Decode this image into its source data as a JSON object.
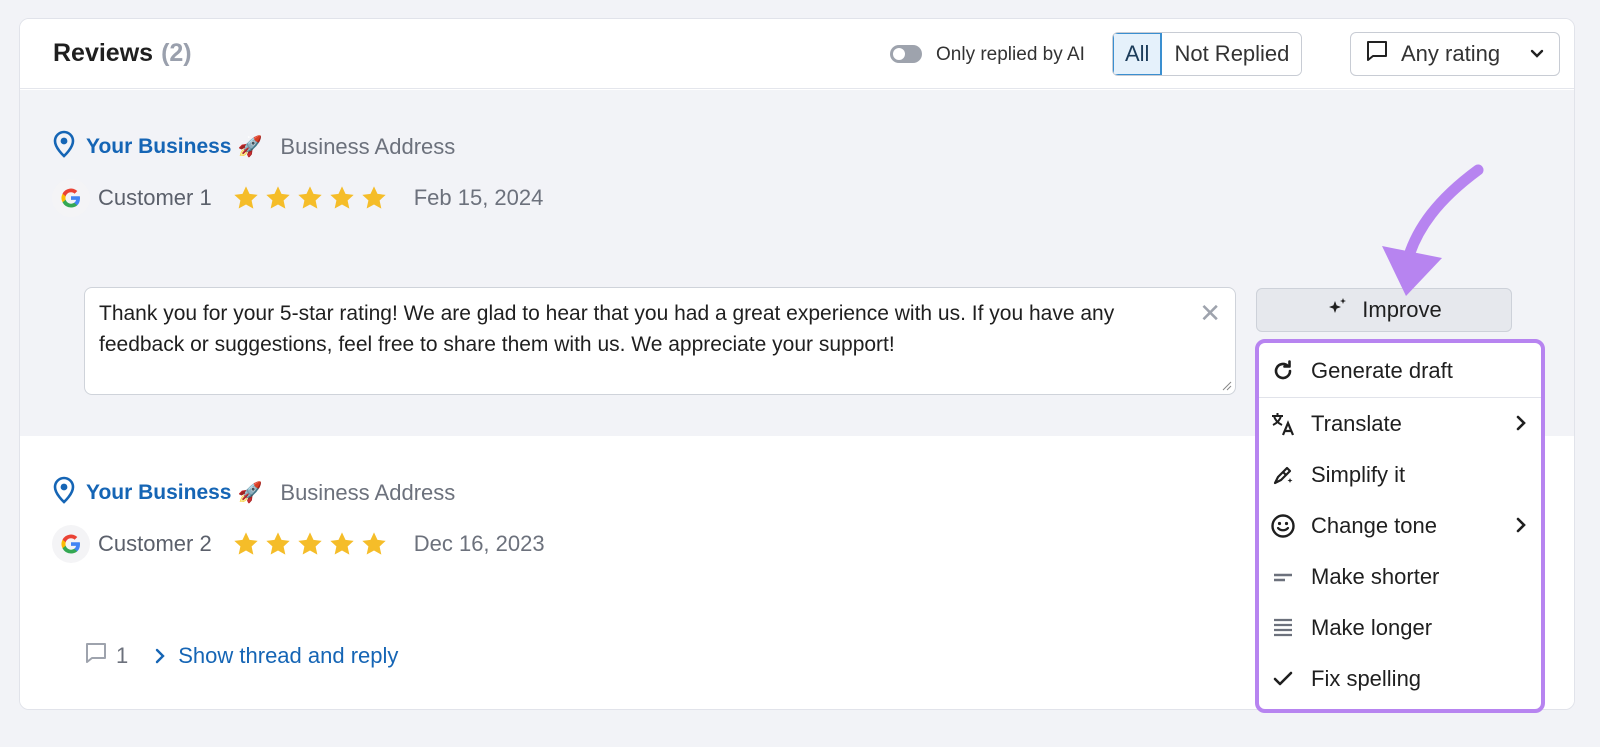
{
  "header": {
    "title": "Reviews",
    "count": "(2)",
    "toggle_label": "Only replied by AI",
    "filter_all": "All",
    "filter_not_replied": "Not Replied",
    "rating_filter": "Any rating"
  },
  "reviews": [
    {
      "business": "Your Business",
      "address": "Business Address",
      "customer": "Customer 1",
      "stars": 5,
      "date": "Feb 15, 2024",
      "reply_text": "Thank you for your 5-star rating! We are glad to hear that you had a great experience with us. If you have any feedback or suggestions, feel free to share them with us. We appreciate your support!"
    },
    {
      "business": "Your Business",
      "address": "Business Address",
      "customer": "Customer 2",
      "stars": 5,
      "date": "Dec 16, 2023",
      "thread_count": "1",
      "thread_link": "Show thread and reply"
    }
  ],
  "improve": {
    "button_label": "Improve",
    "menu": [
      {
        "label": "Generate draft",
        "icon": "refresh-icon"
      },
      {
        "label": "Translate",
        "icon": "translate-icon",
        "submenu": true
      },
      {
        "label": "Simplify it",
        "icon": "magic-pen-icon"
      },
      {
        "label": "Change tone",
        "icon": "smile-icon",
        "submenu": true
      },
      {
        "label": "Make shorter",
        "icon": "short-lines-icon"
      },
      {
        "label": "Make longer",
        "icon": "long-lines-icon"
      },
      {
        "label": "Fix spelling",
        "icon": "check-icon"
      }
    ]
  },
  "colors": {
    "accent_link": "#1565b5",
    "star": "#f5bd29",
    "highlight_border": "#b784f0",
    "arrow": "#b784f0"
  }
}
